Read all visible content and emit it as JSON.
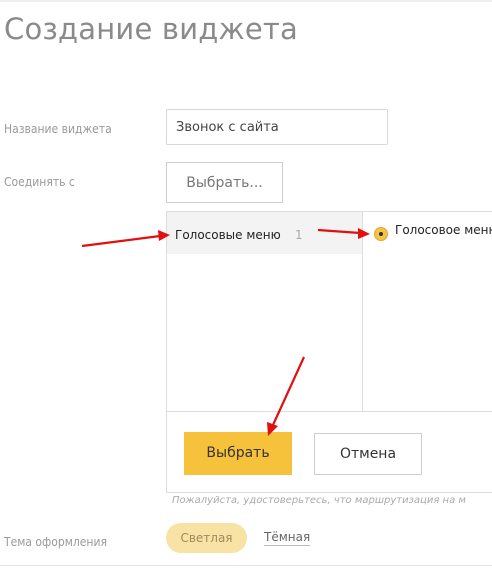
{
  "page": {
    "title": "Создание виджета"
  },
  "form": {
    "name_label": "Название виджета",
    "name_value": "Звонок с сайта",
    "connect_label": "Соединять с",
    "pick_button": "Выбрать..."
  },
  "picker": {
    "category": {
      "label": "Голосовые меню",
      "count": "1"
    },
    "option": {
      "label": "Голосовое меню"
    },
    "choose_button": "Выбрать",
    "cancel_button": "Отмена"
  },
  "note": "Пожалуйста, удостоверьтесь, что маршрутизация на м",
  "theme": {
    "label": "Тема оформления",
    "light": "Светлая",
    "dark": "Тёмная"
  },
  "colors": {
    "accent": "#f6c13b",
    "annotation": "#e01010"
  }
}
